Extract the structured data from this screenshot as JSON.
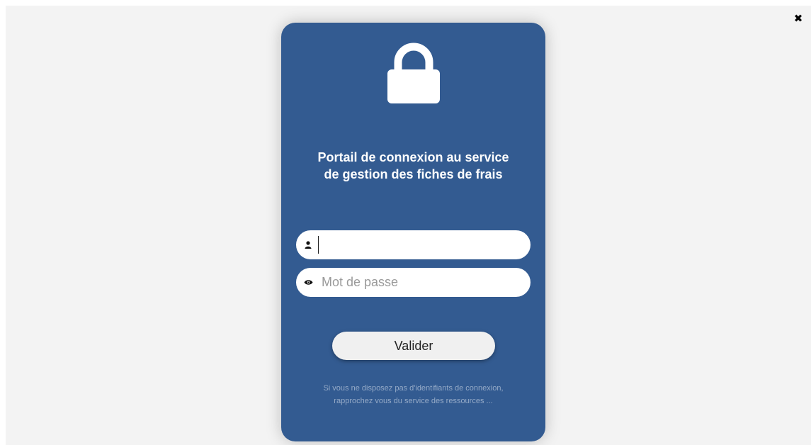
{
  "window": {
    "close_icon": "close-icon",
    "close_glyph": "✖"
  },
  "card": {
    "background": "#335b91",
    "lock_icon": "lock-icon",
    "title_line1": "Portail de connexion au service",
    "title_line2": "de gestion des fiches de frais"
  },
  "login": {
    "username_icon": "user-icon",
    "username_value": "",
    "username_placeholder": "",
    "password_icon": "eye-icon",
    "password_value": "",
    "password_placeholder": "Mot de passe",
    "submit_label": "Valider"
  },
  "footer_note": {
    "line1": "Si vous ne disposez pas d'identifiants de connexion,",
    "line2": "rapprochez vous du service des ressources ..."
  }
}
